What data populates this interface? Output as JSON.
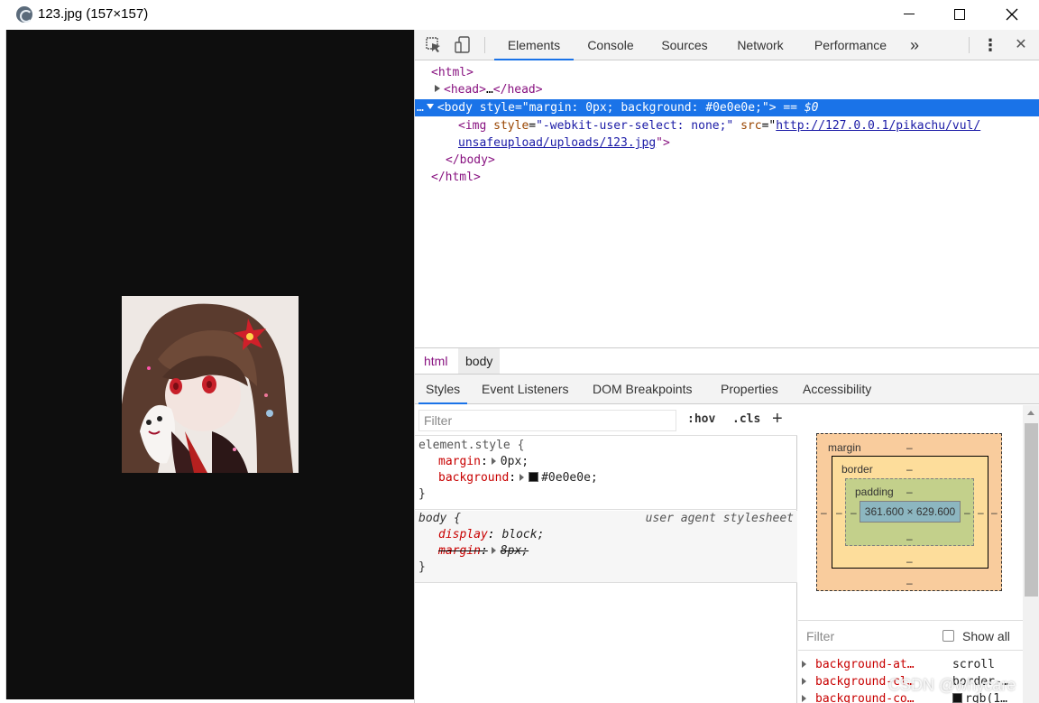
{
  "window": {
    "title": "123.jpg (157×157)"
  },
  "devtools": {
    "tabs": [
      "Elements",
      "Console",
      "Sources",
      "Network",
      "Performance"
    ],
    "more_label": "»",
    "menu_label": "⋮",
    "close_label": "✕"
  },
  "tree": {
    "l1": "<html>",
    "l2_open": "<head>",
    "l2_ellipsis": "…",
    "l2_close": "</head>",
    "l3_dots": "…",
    "l3_tag_open": "<body",
    "l3_attr": "style",
    "l3_val": "\"margin: 0px; background: #0e0e0e;\"",
    "l3_tag_close": ">",
    "l3_eq": "== $0",
    "l4_tag": "<img",
    "l4_attr1": "style",
    "l4_val1": "\"-webkit-user-select: none;\"",
    "l4_attr2": "src",
    "l4_link1": "http://127.0.0.1/pikachu/vul/",
    "l5_link2": "unsafeupload/uploads/123.jpg",
    "l5_close": "\">",
    "l6": "</body>",
    "l7": "</html>"
  },
  "crumbs": [
    "html",
    "body"
  ],
  "subtabs": [
    "Styles",
    "Event Listeners",
    "DOM Breakpoints",
    "Properties",
    "Accessibility"
  ],
  "styles": {
    "filter_placeholder": "Filter",
    "hov": ":hov",
    "cls": ".cls",
    "plus": "+",
    "rule1": {
      "selector": "element.style {",
      "p1": "margin",
      "v1": "0px;",
      "p2": "background",
      "v2": "#0e0e0e;",
      "close": "}"
    },
    "rule2": {
      "selector": "body {",
      "source": "user agent stylesheet",
      "p1": "display",
      "v1": "block;",
      "p2": "margin",
      "v2": "8px;",
      "close": "}"
    }
  },
  "boxmodel": {
    "margin_label": "margin",
    "border_label": "border",
    "padding_label": "padding",
    "dash": "–",
    "content": "361.600 × 629.600"
  },
  "computed": {
    "filter_placeholder": "Filter",
    "show_all": "Show all",
    "rows": [
      {
        "name": "background-at…",
        "value": "scroll"
      },
      {
        "name": "background-cl…",
        "value": "border-…"
      },
      {
        "name": "background-co…",
        "value": "rgb(1…"
      }
    ]
  },
  "watermark": "CSDN @whycare"
}
